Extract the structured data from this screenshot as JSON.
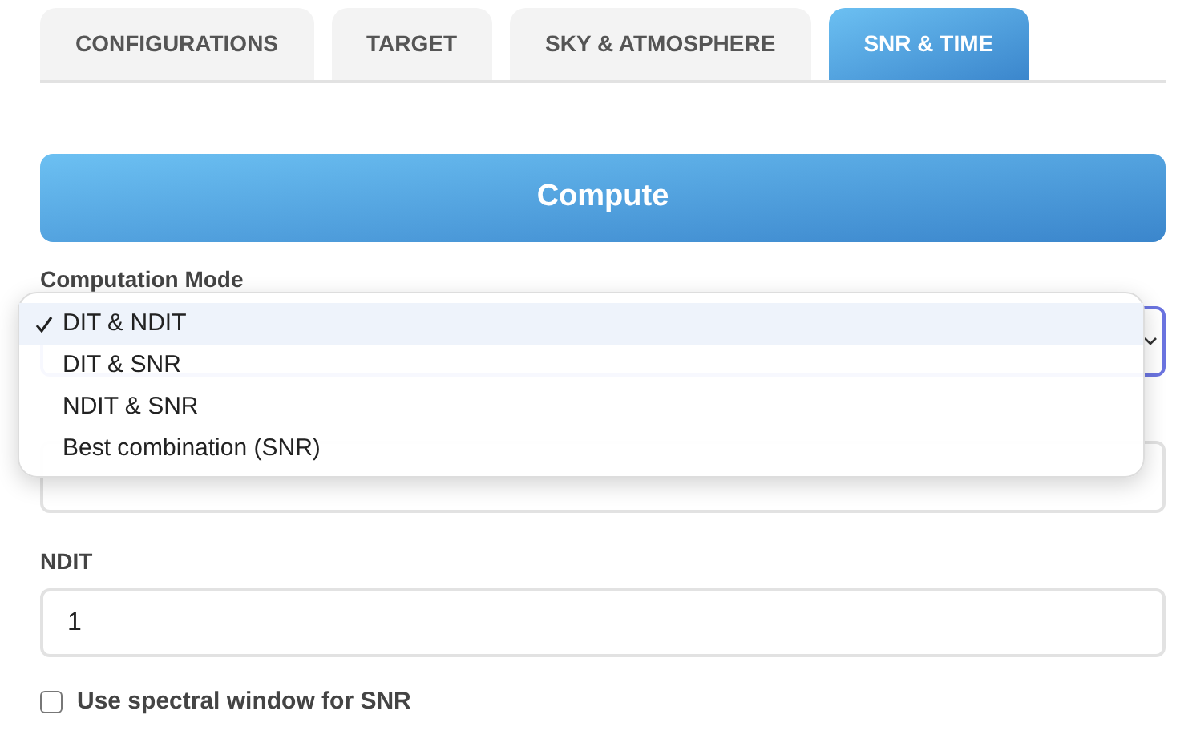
{
  "tabs": [
    {
      "label": "CONFIGURATIONS",
      "selected": false
    },
    {
      "label": "TARGET",
      "selected": false
    },
    {
      "label": "SKY & ATMOSPHERE",
      "selected": false
    },
    {
      "label": "SNR & TIME",
      "selected": true
    }
  ],
  "compute_button": "Compute",
  "computation_mode": {
    "label": "Computation Mode",
    "expanded": true,
    "options": [
      {
        "label": "DIT & NDIT",
        "selected": true
      },
      {
        "label": "DIT & SNR",
        "selected": false
      },
      {
        "label": "NDIT & SNR",
        "selected": false
      },
      {
        "label": "Best combination (SNR)",
        "selected": false
      }
    ]
  },
  "ndit": {
    "label": "NDIT",
    "value": "1"
  },
  "spectral_window": {
    "label": "Use spectral window for SNR",
    "checked": false
  }
}
